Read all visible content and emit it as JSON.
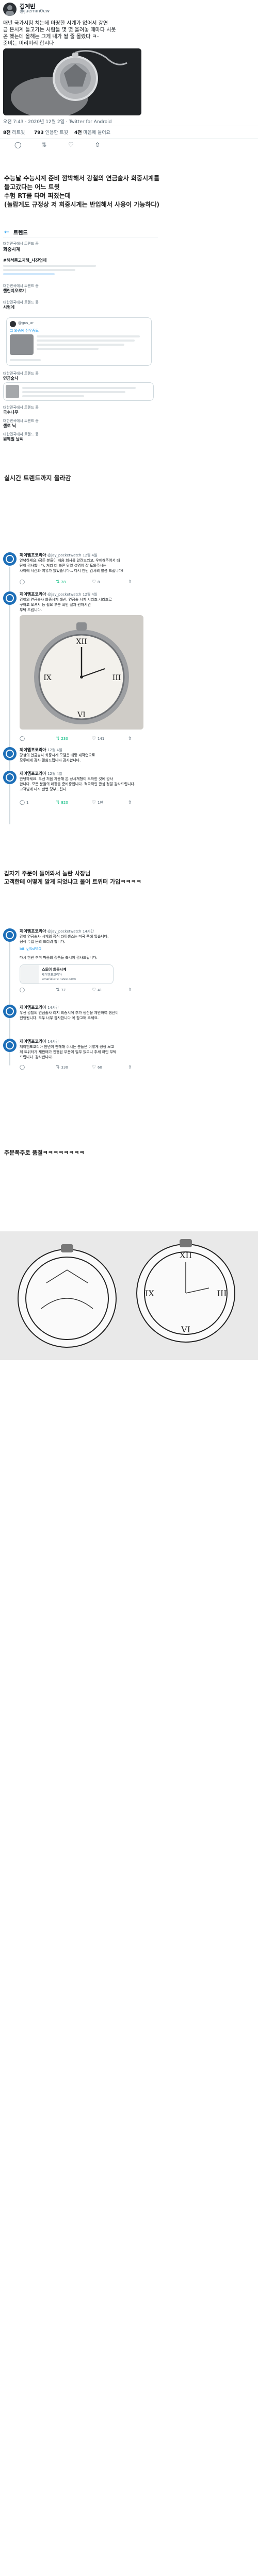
{
  "section1": {
    "author_name": "김계빈",
    "author_handle": "@jaemin0ew",
    "tweet_text": "매년 국가시험 치는데 마땅한 시계가 없어서 강연\n금 은시계 들고가는 사람들 몇 몇 올려놓 때마다 처웃\n곤 했는데 올해는 그게 내가 될 줄 몰랐다 ㅋ-\n준비는 미리미리 합시다",
    "meta": "오전 7:43 · 2020년 12월 2일 · Twitter for Android",
    "stats": [
      {
        "num": "8천",
        "label": "리트윗"
      },
      {
        "num": "793",
        "label": "인용한 트윗"
      },
      {
        "num": "4천",
        "label": "마음에 들어요"
      }
    ]
  },
  "caption1": "수능날 수능시계 준비 깜박해서 강철의 연금술사 회중시계를\n들고갔다는 어느 트윗\n수험 RT를 타며 퍼졌는데\n(놀랍게도 규정상 저 회중시계는 반입해서 사용이 가능하다)",
  "trends": {
    "header": "트렌드",
    "items": [
      {
        "category": "대한민국에서 트렌드 중",
        "topic": "회중시계",
        "count": ""
      },
      {
        "category": "",
        "topic": "#해석중고지해_사진업체",
        "count": ""
      },
      {
        "category": "",
        "topic": "",
        "count": ""
      },
      {
        "category": "대한민국에서 트렌드 중",
        "topic": "챌린지오로기",
        "count": ""
      },
      {
        "category": "대한민국에서 트렌드 중",
        "topic": "시험에",
        "count": ""
      },
      {
        "category": "대한민국에서 트렌드 중",
        "topic": "연금술사",
        "count": ""
      },
      {
        "category": "대한민국에서 트렌드 중",
        "topic": "국수나무",
        "count": ""
      },
      {
        "category": "대한민국에서 트렌드 중",
        "topic": "셀로 닉",
        "count": ""
      },
      {
        "category": "대한민국에서 트렌드 중",
        "topic": "원웨일 날씨",
        "count": ""
      }
    ],
    "embedded_handle": "@gus_ar",
    "embedded_title": "그 와중에 전우중도"
  },
  "caption2": "실시간 트렌드까지 올라감",
  "thread": {
    "name": "제이엠포코리아",
    "handle": "@jay_pocketwatch",
    "tweets": [
      {
        "time": "12월 4일",
        "text": "안녕하세요:)정든 분들이 처음 회사를 알려드리고, 우제해주어서 대\n단히 감사합니다. 처리 더 빠른 당일 설명이 잘 도와주시는\n사이에 시간과 여유가 있었습니다... 다시 한번 감사의 말씀 드립니다!",
        "stats": [
          "",
          "28",
          "8",
          ""
        ]
      },
      {
        "time": "12월 4일",
        "text": "강철의 연금술사 회중시계 대신, 연금술 시계 시리즈 시리즈로\n구하고 오셔서 등 필요 부분 확인 절차 원하시면\n부탁 드립니다.",
        "stats": [
          "",
          "230",
          "141",
          ""
        ]
      },
      {
        "time": "12월 4일",
        "text": "강철의 연금술사 회중시계 모델은 대량 재작업으로\n모두에게 감사 말씀드립니다 감사합니다.",
        "stats": [
          "1",
          "",
          "",
          ""
        ]
      },
      {
        "time": "12월 4일",
        "text": "안녕하세요. 우선 처음 자중해 본 상시계형이 도착한 것에 감사\n합니다. 모든 분들의 매장을 준비중입니다. 적극적인 관심 정말 감사드립니다.\n고객님께 다시 한번 당부드린다.",
        "stats": [
          "1",
          "820",
          "1천",
          ""
        ]
      }
    ]
  },
  "caption3": "갑자기 주문이 들어와서 놀란 사장님\n고객한테 어떻게 알게 되었냐고 물어 트위터 가입ㅋㅋㅋㅋ",
  "thread2": {
    "name": "제이엠포코리아",
    "handle": "@jay_pocketwatch",
    "tweets": [
      {
        "time": "14시간",
        "text": "강철 연금술사 시계의 정식 라이센스는 미국 쪽에 있습니다.\n정식 수입 문의 드리려 합니다.",
        "link": "bit.ly/SsPEO",
        "stats": [
          "",
          "37",
          "41",
          ""
        ]
      },
      {
        "time": "14시간",
        "text": "다시 한번 추석 마음의 정품들 축시어 감사드립니다.",
        "stats": [
          "",
          "",
          "",
          ""
        ]
      },
      {
        "time": "14시간",
        "text": "우선 강철의 연금술사 리지 회중시계 추가 생산을 제안하여 생산이\n진행됩니다. 모두 너무 감사합니다 꼭 참고해 주세요.",
        "link": "",
        "stats": [
          "",
          "",
          "",
          ""
        ]
      },
      {
        "time": "14시간",
        "text": "제이엠포코리아 원년이 판매해 주시는 분들은 이렇게 성정 보고\n제 트위터가 재판매가 진행된 부분이 일부 있으니 추세 확인 부탁\n드립니다. 감사합니다.",
        "stats": [
          "",
          "330",
          "60",
          ""
        ]
      }
    ],
    "card_title": "스토어 회중시계",
    "card_sub": "제이엠포코리아",
    "card_url": "smartstore.naver.com"
  },
  "caption4": "주문폭주로 품절ㅋㅋㅋㅋㅋㅋㅋㅋ"
}
